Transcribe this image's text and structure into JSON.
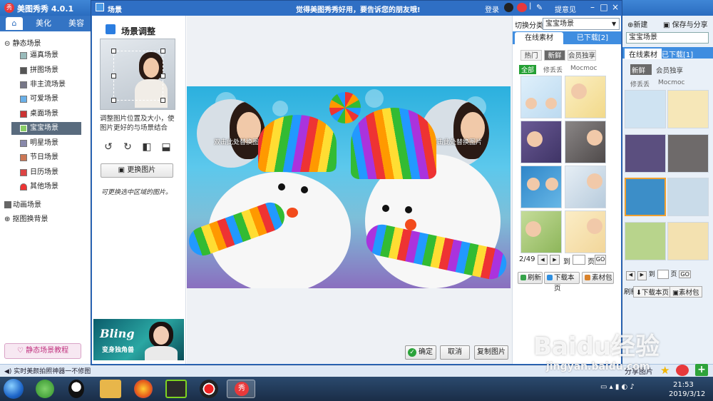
{
  "app": {
    "title": "美图秀秀 4.0.1",
    "tabs": [
      "美化",
      "美容"
    ],
    "new_label": "新建",
    "save_share_label": "保存与分享",
    "share_picture_label": "分享图片"
  },
  "sidebar": {
    "group_static": "静态场景",
    "items": [
      "逼真场景",
      "拼图场景",
      "非主流场景",
      "可爱场景",
      "桌面场景",
      "宝宝场景",
      "明星场景",
      "节日场景",
      "日历场景",
      "其他场景"
    ],
    "group_animated": "动画场景",
    "group_cutout": "抠图换背景",
    "tutorial_button": "静态场景教程"
  },
  "status_bar": {
    "text": "实时美颜拍照神器一不修图"
  },
  "dialog": {
    "title": "场景",
    "ad_text": "觉得美图秀秀好用，要告诉您的朋友哦!",
    "login": "登录",
    "feedback": "提意见"
  },
  "adjust": {
    "title": "场景调整",
    "description": "调整图片位置及大小，使图片更好的与场景结合",
    "replace_button": "更换图片",
    "hint": "可更换选中区域的图片。",
    "banner_title": "Bling",
    "banner_subtitle": "变身独角兽"
  },
  "canvas": {
    "photo_hint_left": "双击此处替换图片",
    "photo_hint_right": "双击此处替换图片",
    "ok_button": "确定",
    "cancel_button": "取消",
    "copy_button": "复制图片"
  },
  "materials": {
    "switch_label": "切换分类",
    "category": "宝宝场景",
    "tab_online": "在线素材",
    "tab_downloaded": "已下载[2]",
    "tab_downloaded_bg": "已下载[1]",
    "subtabs": [
      "热门",
      "新鲜",
      "会员独享"
    ],
    "filters": [
      "全部",
      "修丢丢",
      "Mocmoc"
    ],
    "pager": "2/49",
    "pager_to": "到",
    "pager_page": "页",
    "go": "GO",
    "refresh": "刷新",
    "download_page": "下载本页",
    "material_pack": "素材包"
  },
  "taskbar": {
    "time": "21:53",
    "date": "2019/3/12"
  },
  "watermark": {
    "main": "Baidu经验",
    "url": "jingyan.baidu.com"
  },
  "colors": {
    "title_blue": "#2f6fc4",
    "tab_blue": "#3f8de0",
    "selected_item": "#596b7e",
    "ok_green": "#2aa33a"
  }
}
